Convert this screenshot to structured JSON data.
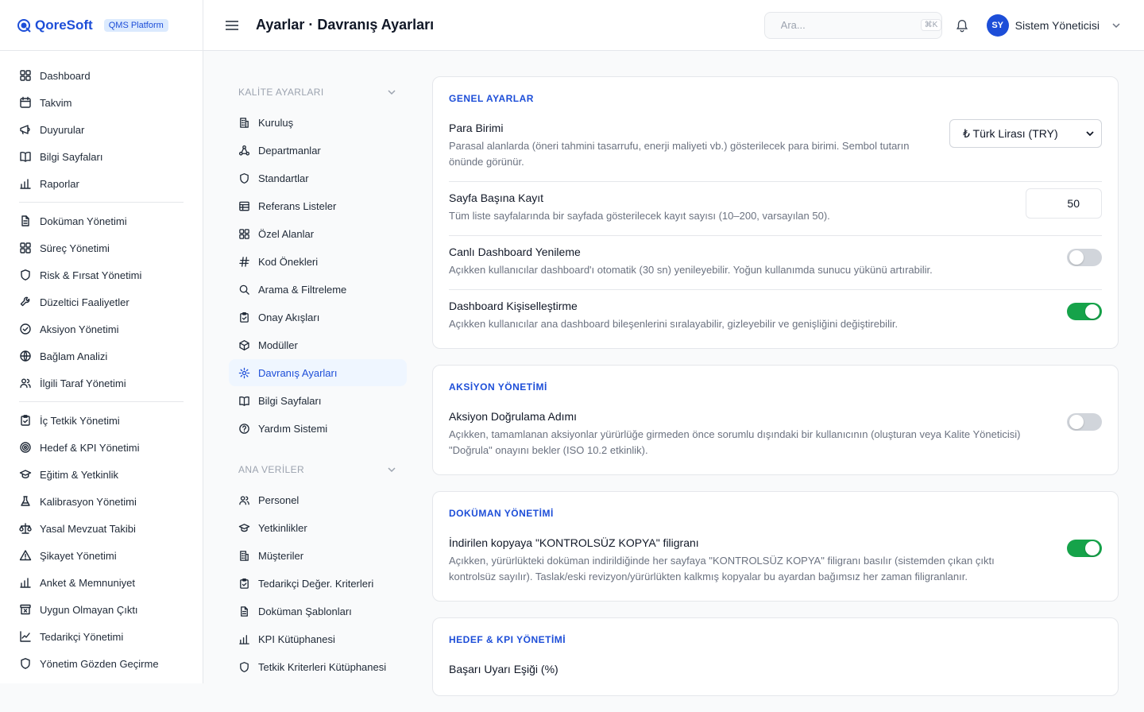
{
  "brand": {
    "name": "QoreSoft",
    "badge": "QMS Platform"
  },
  "header": {
    "title": "Ayarlar · Davranış Ayarları",
    "search_placeholder": "Ara...",
    "shortcut": "⌘K",
    "user_initials": "SY",
    "user_name": "Sistem Yöneticisi"
  },
  "sidebar": {
    "groups": [
      [
        "Dashboard",
        "Takvim",
        "Duyurular",
        "Bilgi Sayfaları",
        "Raporlar"
      ],
      [
        "Doküman Yönetimi",
        "Süreç Yönetimi",
        "Risk & Fırsat Yönetimi",
        "Düzeltici Faaliyetler",
        "Aksiyon Yönetimi",
        "Bağlam Analizi",
        "İlgili Taraf Yönetimi"
      ],
      [
        "İç Tetkik Yönetimi",
        "Hedef & KPI Yönetimi",
        "Eğitim & Yetkinlik",
        "Kalibrasyon Yönetimi",
        "Yasal Mevzuat Takibi",
        "Şikayet Yönetimi",
        "Anket & Memnuniyet",
        "Uygun Olmayan Çıktı",
        "Tedarikçi Yönetimi",
        "Yönetim Gözden Geçirme"
      ]
    ]
  },
  "subnav": {
    "quality_title": "KALİTE AYARLARI",
    "quality_items": [
      "Kuruluş",
      "Departmanlar",
      "Standartlar",
      "Referans Listeler",
      "Özel Alanlar",
      "Kod Önekleri",
      "Arama & Filtreleme",
      "Onay Akışları",
      "Modüller",
      "Davranış Ayarları",
      "Bilgi Sayfaları",
      "Yardım Sistemi"
    ],
    "master_title": "ANA VERİLER",
    "master_items": [
      "Personel",
      "Yetkinlikler",
      "Müşteriler",
      "Tedarikçi Değer. Kriterleri",
      "Doküman Şablonları",
      "KPI Kütüphanesi",
      "Tetkik Kriterleri Kütüphanesi"
    ]
  },
  "cards": {
    "general": {
      "title": "GENEL AYARLAR",
      "currency_label": "Para Birimi",
      "currency_desc": "Parasal alanlarda (öneri tahmini tasarrufu, enerji maliyeti vb.) gösterilecek para birimi. Sembol tutarın önünde görünür.",
      "currency_value": "₺ Türk Lirası (TRY)",
      "page_label": "Sayfa Başına Kayıt",
      "page_desc": "Tüm liste sayfalarında bir sayfada gösterilecek kayıt sayısı (10–200, varsayılan 50).",
      "page_value": "50",
      "live_label": "Canlı Dashboard Yenileme",
      "live_desc": "Açıkken kullanıcılar dashboard'ı otomatik (30 sn) yenileyebilir. Yoğun kullanımda sunucu yükünü artırabilir.",
      "live_on": false,
      "custom_label": "Dashboard Kişiselleştirme",
      "custom_desc": "Açıkken kullanıcılar ana dashboard bileşenlerini sıralayabilir, gizleyebilir ve genişliğini değiştirebilir.",
      "custom_on": true
    },
    "action": {
      "title": "AKSİYON YÖNETİMİ",
      "verify_label": "Aksiyon Doğrulama Adımı",
      "verify_desc": "Açıkken, tamamlanan aksiyonlar yürürlüğe girmeden önce sorumlu dışındaki bir kullanıcının (oluşturan veya Kalite Yöneticisi) \"Doğrula\" onayını bekler (ISO 10.2 etkinlik).",
      "verify_on": false
    },
    "document": {
      "title": "DOKÜMAN YÖNETİMİ",
      "wm_label": "İndirilen kopyaya \"KONTROLSÜZ KOPYA\" filigranı",
      "wm_desc": "Açıkken, yürürlükteki doküman indirildiğinde her sayfaya \"KONTROLSÜZ KOPYA\" filigranı basılır (sistemden çıkan çıktı kontrolsüz sayılır). Taslak/eski revizyon/yürürlükten kalkmış kopyalar bu ayardan bağımsız her zaman filigranlanır.",
      "wm_on": true
    },
    "kpi": {
      "title": "HEDEF & KPI YÖNETİMİ",
      "threshold_label": "Başarı Uyarı Eşiği (%)"
    }
  }
}
